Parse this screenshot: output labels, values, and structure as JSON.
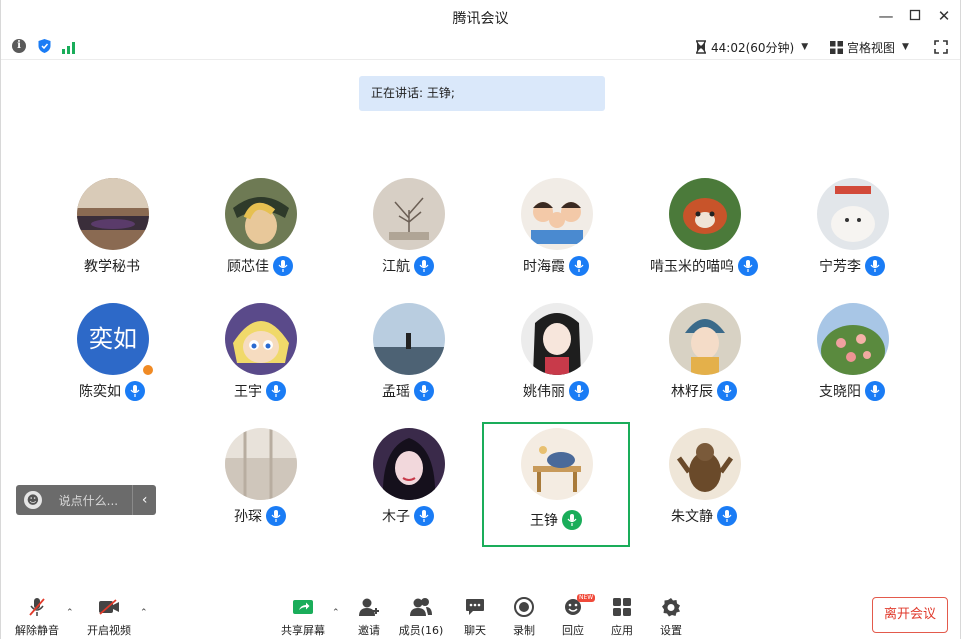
{
  "window": {
    "title": "腾讯会议"
  },
  "topbar": {
    "timer": "44:02(60分钟)",
    "view_mode": "宫格视图"
  },
  "speaking_banner": "正在讲话: 王铮;",
  "participants": [
    {
      "name": "教学秘书"
    },
    {
      "name": "顾芯佳"
    },
    {
      "name": "江航"
    },
    {
      "name": "时海霞"
    },
    {
      "name": "啃玉米的喵呜"
    },
    {
      "name": "宁芳李"
    },
    {
      "name": "陈奕如",
      "avatar_text": "奕如"
    },
    {
      "name": "王宇"
    },
    {
      "name": "孟瑶"
    },
    {
      "name": "姚伟丽"
    },
    {
      "name": "林籽辰"
    },
    {
      "name": "支晓阳"
    },
    {
      "name": "孙琛"
    },
    {
      "name": "木子"
    },
    {
      "name": "王铮"
    },
    {
      "name": "朱文静"
    }
  ],
  "chat": {
    "placeholder": "说点什么..."
  },
  "bottom_bar": {
    "unmute": "解除静音",
    "start_video": "开启视频",
    "share_screen": "共享屏幕",
    "invite": "邀请",
    "members": "成员(16)",
    "chat": "聊天",
    "record": "录制",
    "reactions": "回应",
    "reactions_badge": "NEW",
    "apps": "应用",
    "settings": "设置",
    "leave": "离开会议"
  },
  "colors": {
    "accent": "#1a7cf5",
    "active_speaker": "#1aad5a",
    "leave": "#e03a2c"
  }
}
